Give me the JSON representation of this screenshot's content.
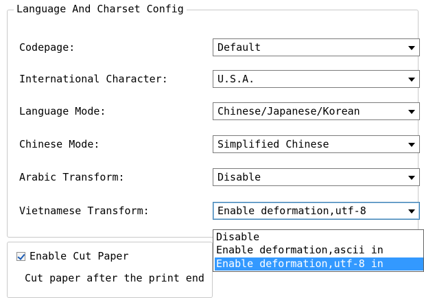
{
  "group": {
    "title": "Language And Charset Config"
  },
  "rows": [
    {
      "label": "Codepage:",
      "value": "Default"
    },
    {
      "label": "International Character:",
      "value": "U.S.A."
    },
    {
      "label": "Language Mode:",
      "value": "Chinese/Japanese/Korean"
    },
    {
      "label": "Chinese Mode:",
      "value": "Simplified Chinese"
    },
    {
      "label": "Arabic Transform:",
      "value": "Disable"
    },
    {
      "label": "Vietnamese Transform:",
      "value": "Enable deformation,utf-8"
    }
  ],
  "dropdown": {
    "options": [
      "Disable",
      "Enable deformation,ascii in",
      "Enable deformation,utf-8 in"
    ],
    "selected_index": 2
  },
  "cut_paper": {
    "label": "Enable Cut Paper",
    "checked": true
  },
  "partial_text": "Cut paper after the      print end",
  "colors": {
    "selection": "#3399ff",
    "checkmark": "#1a5bb5",
    "border": "#c9c9c9"
  }
}
